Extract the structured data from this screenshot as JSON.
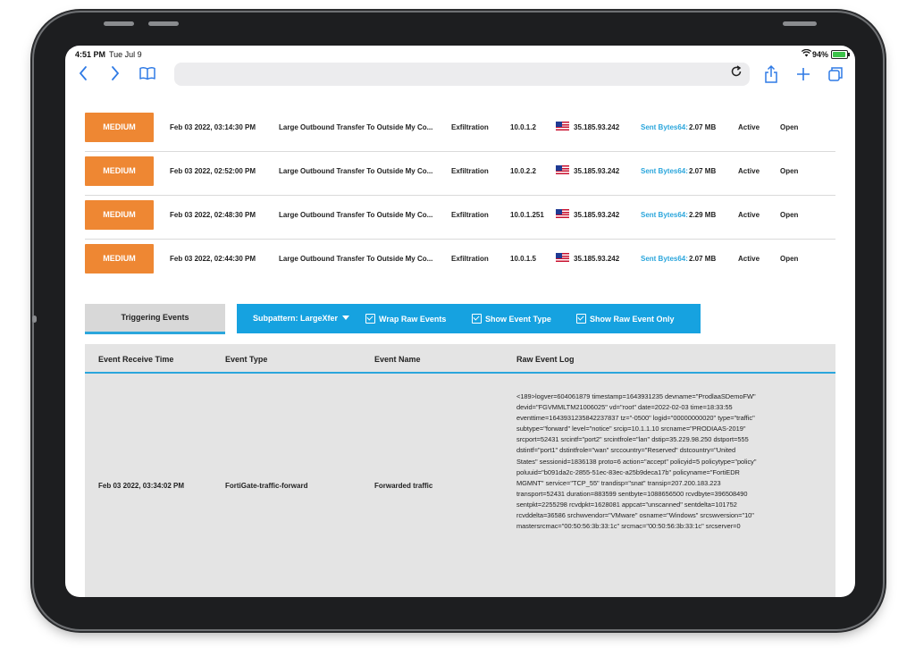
{
  "status_bar": {
    "time": "4:51 PM",
    "date": "Tue Jul 9",
    "battery": "94%"
  },
  "toolbar": {
    "back_icon": "chevron-left-icon",
    "forward_icon": "chevron-right-icon",
    "bookmarks_icon": "book-icon",
    "reload_icon": "reload-icon",
    "share_icon": "share-icon",
    "new_tab_icon": "plus-icon",
    "tabs_icon": "tabs-icon"
  },
  "colors": {
    "severity_medium": "#ee8733",
    "accent_blue": "#16a2e0",
    "link_blue": "#2ba6dc"
  },
  "alerts": [
    {
      "severity": "MEDIUM",
      "time": "Feb 03 2022, 03:14:30 PM",
      "name": "Large Outbound Transfer To Outside My Co...",
      "tactic": "Exfiltration",
      "src_ip": "10.0.1.2",
      "dst_ip": "35.185.93.242",
      "sent_label": "Sent Bytes64:",
      "sent_value": "2.07 MB",
      "status": "Active",
      "state": "Open"
    },
    {
      "severity": "MEDIUM",
      "time": "Feb 03 2022, 02:52:00 PM",
      "name": "Large Outbound Transfer To Outside My Co...",
      "tactic": "Exfiltration",
      "src_ip": "10.0.2.2",
      "dst_ip": "35.185.93.242",
      "sent_label": "Sent Bytes64:",
      "sent_value": "2.07 MB",
      "status": "Active",
      "state": "Open"
    },
    {
      "severity": "MEDIUM",
      "time": "Feb 03 2022, 02:48:30 PM",
      "name": "Large Outbound Transfer To Outside My Co...",
      "tactic": "Exfiltration",
      "src_ip": "10.0.1.251",
      "dst_ip": "35.185.93.242",
      "sent_label": "Sent Bytes64:",
      "sent_value": "2.29 MB",
      "status": "Active",
      "state": "Open"
    },
    {
      "severity": "MEDIUM",
      "time": "Feb 03 2022, 02:44:30 PM",
      "name": "Large Outbound Transfer To Outside My Co...",
      "tactic": "Exfiltration",
      "src_ip": "10.0.1.5",
      "dst_ip": "35.185.93.242",
      "sent_label": "Sent Bytes64:",
      "sent_value": "2.07 MB",
      "status": "Active",
      "state": "Open"
    }
  ],
  "tabs": {
    "triggering_events": "Triggering Events"
  },
  "options": {
    "subpattern": "Subpattern: LargeXfer",
    "wrap_raw": "Wrap Raw Events",
    "show_event_type": "Show Event Type",
    "show_raw_only": "Show Raw Event Only"
  },
  "events_table": {
    "columns": [
      "Event Receive Time",
      "Event Type",
      "Event Name",
      "Raw Event Log"
    ],
    "rows": [
      {
        "receive_time": "Feb 03 2022, 03:34:02 PM",
        "event_type": "FortiGate-traffic-forward",
        "event_name": "Forwarded traffic",
        "raw_lines": [
          "<189>logver=604061879 timestamp=1643931235 devname=\"ProdlaaSDemoFW\"",
          "devid=\"FGVMMLTM21006025\" vd=\"root\" date=2022-02-03 time=18:33:55",
          "eventtime=1643931235842237837 tz=\"-0500\" logid=\"00000000020\" type=\"traffic\"",
          "subtype=\"forward\" level=\"notice\" srcip=10.1.1.10 srcname=\"PRODIAAS-2019\"",
          "srcport=52431 srcintf=\"port2\" srcintfrole=\"lan\" dstip=35.229.98.250 dstport=555",
          "dstintf=\"port1\" dstintfrole=\"wan\" srccountry=\"Reserved\" dstcountry=\"United",
          "States\" sessionid=1836138 proto=6 action=\"accept\" policyid=5 policytype=\"policy\"",
          "poluuid=\"b091da2c-2855-51ec-83ec-a25b9deca17b\" policyname=\"FortiEDR",
          "MGMNT\" service=\"TCP_55\" trandisp=\"snat\" transip=207.200.183.223",
          "transport=52431 duration=883599 sentbyte=1088656500 rcvdbyte=396508490",
          "sentpkt=2255298 rcvdpkt=1628081 appcat=\"unscanned\" sentdelta=101752",
          "rcvddelta=36586 srchwvendor=\"VMware\" osname=\"Windows\" srcswversion=\"10\"",
          "mastersrcmac=\"00:50:56:3b:33:1c\" srcmac=\"00:50:56:3b:33:1c\" srcserver=0"
        ]
      }
    ]
  }
}
